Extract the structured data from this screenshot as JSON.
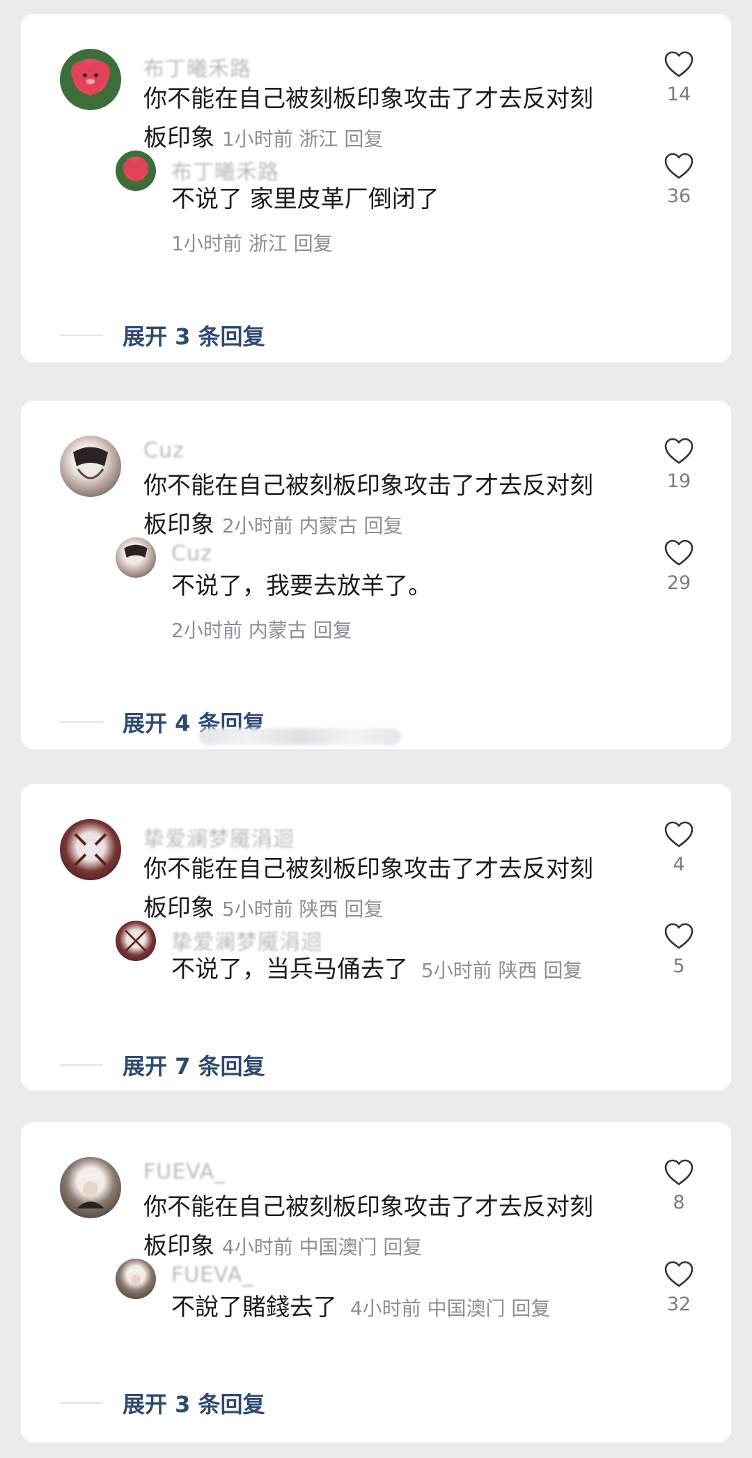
{
  "threads": [
    {
      "author": "布丁曦禾路",
      "text_line1": "你不能在自己被刻板印象攻击了才去反对刻",
      "text_line2": "板印象",
      "meta": "1小时前 浙江 回复",
      "likes": "14",
      "avatar_color": "#d94c5c",
      "reply": {
        "author": "布丁曦禾路",
        "text": "不说了 家里皮革厂倒闭了",
        "meta": "1小时前 浙江 回复",
        "likes": "36"
      },
      "expand_label": "展开 3 条回复"
    },
    {
      "author": "Cuz",
      "text_line1": "你不能在自己被刻板印象攻击了才去反对刻",
      "text_line2": "板印象",
      "meta": "2小时前 内蒙古 回复",
      "likes": "19",
      "avatar_color": "#c9b7b2",
      "reply": {
        "author": "Cuz",
        "text": "不说了，我要去放羊了。",
        "meta": "2小时前 内蒙古 回复",
        "likes": "29"
      },
      "expand_label": "展开 4 条回复"
    },
    {
      "author": "挚爱澜梦魇涓迴",
      "text_line1": "你不能在自己被刻板印象攻击了才去反对刻",
      "text_line2": "板印象",
      "meta": "5小时前 陕西 回复",
      "likes": "4",
      "avatar_color": "#8a4040",
      "reply": {
        "author": "挚爱澜梦魇涓迴",
        "text": "不说了，当兵马俑去了",
        "meta": "5小时前 陕西 回复",
        "likes": "5"
      },
      "expand_label": "展开 7 条回复"
    },
    {
      "author": "FUEVA_",
      "text_line1": "你不能在自己被刻板印象攻击了才去反对刻",
      "text_line2": "板印象",
      "meta": "4小时前 中国澳门 回复",
      "likes": "8",
      "avatar_color": "#7a6b62",
      "reply": {
        "author": "FUEVA_",
        "text": "不說了賭錢去了",
        "meta": "4小时前 中国澳门 回复",
        "likes": "32"
      },
      "expand_label": "展开 3 条回复"
    }
  ],
  "colors": {
    "accent": "#2d4a72",
    "meta": "#8e8e93",
    "text": "#1c1c1e",
    "background": "#ebebeb"
  },
  "icons": {
    "like": "heart-outline-icon"
  }
}
